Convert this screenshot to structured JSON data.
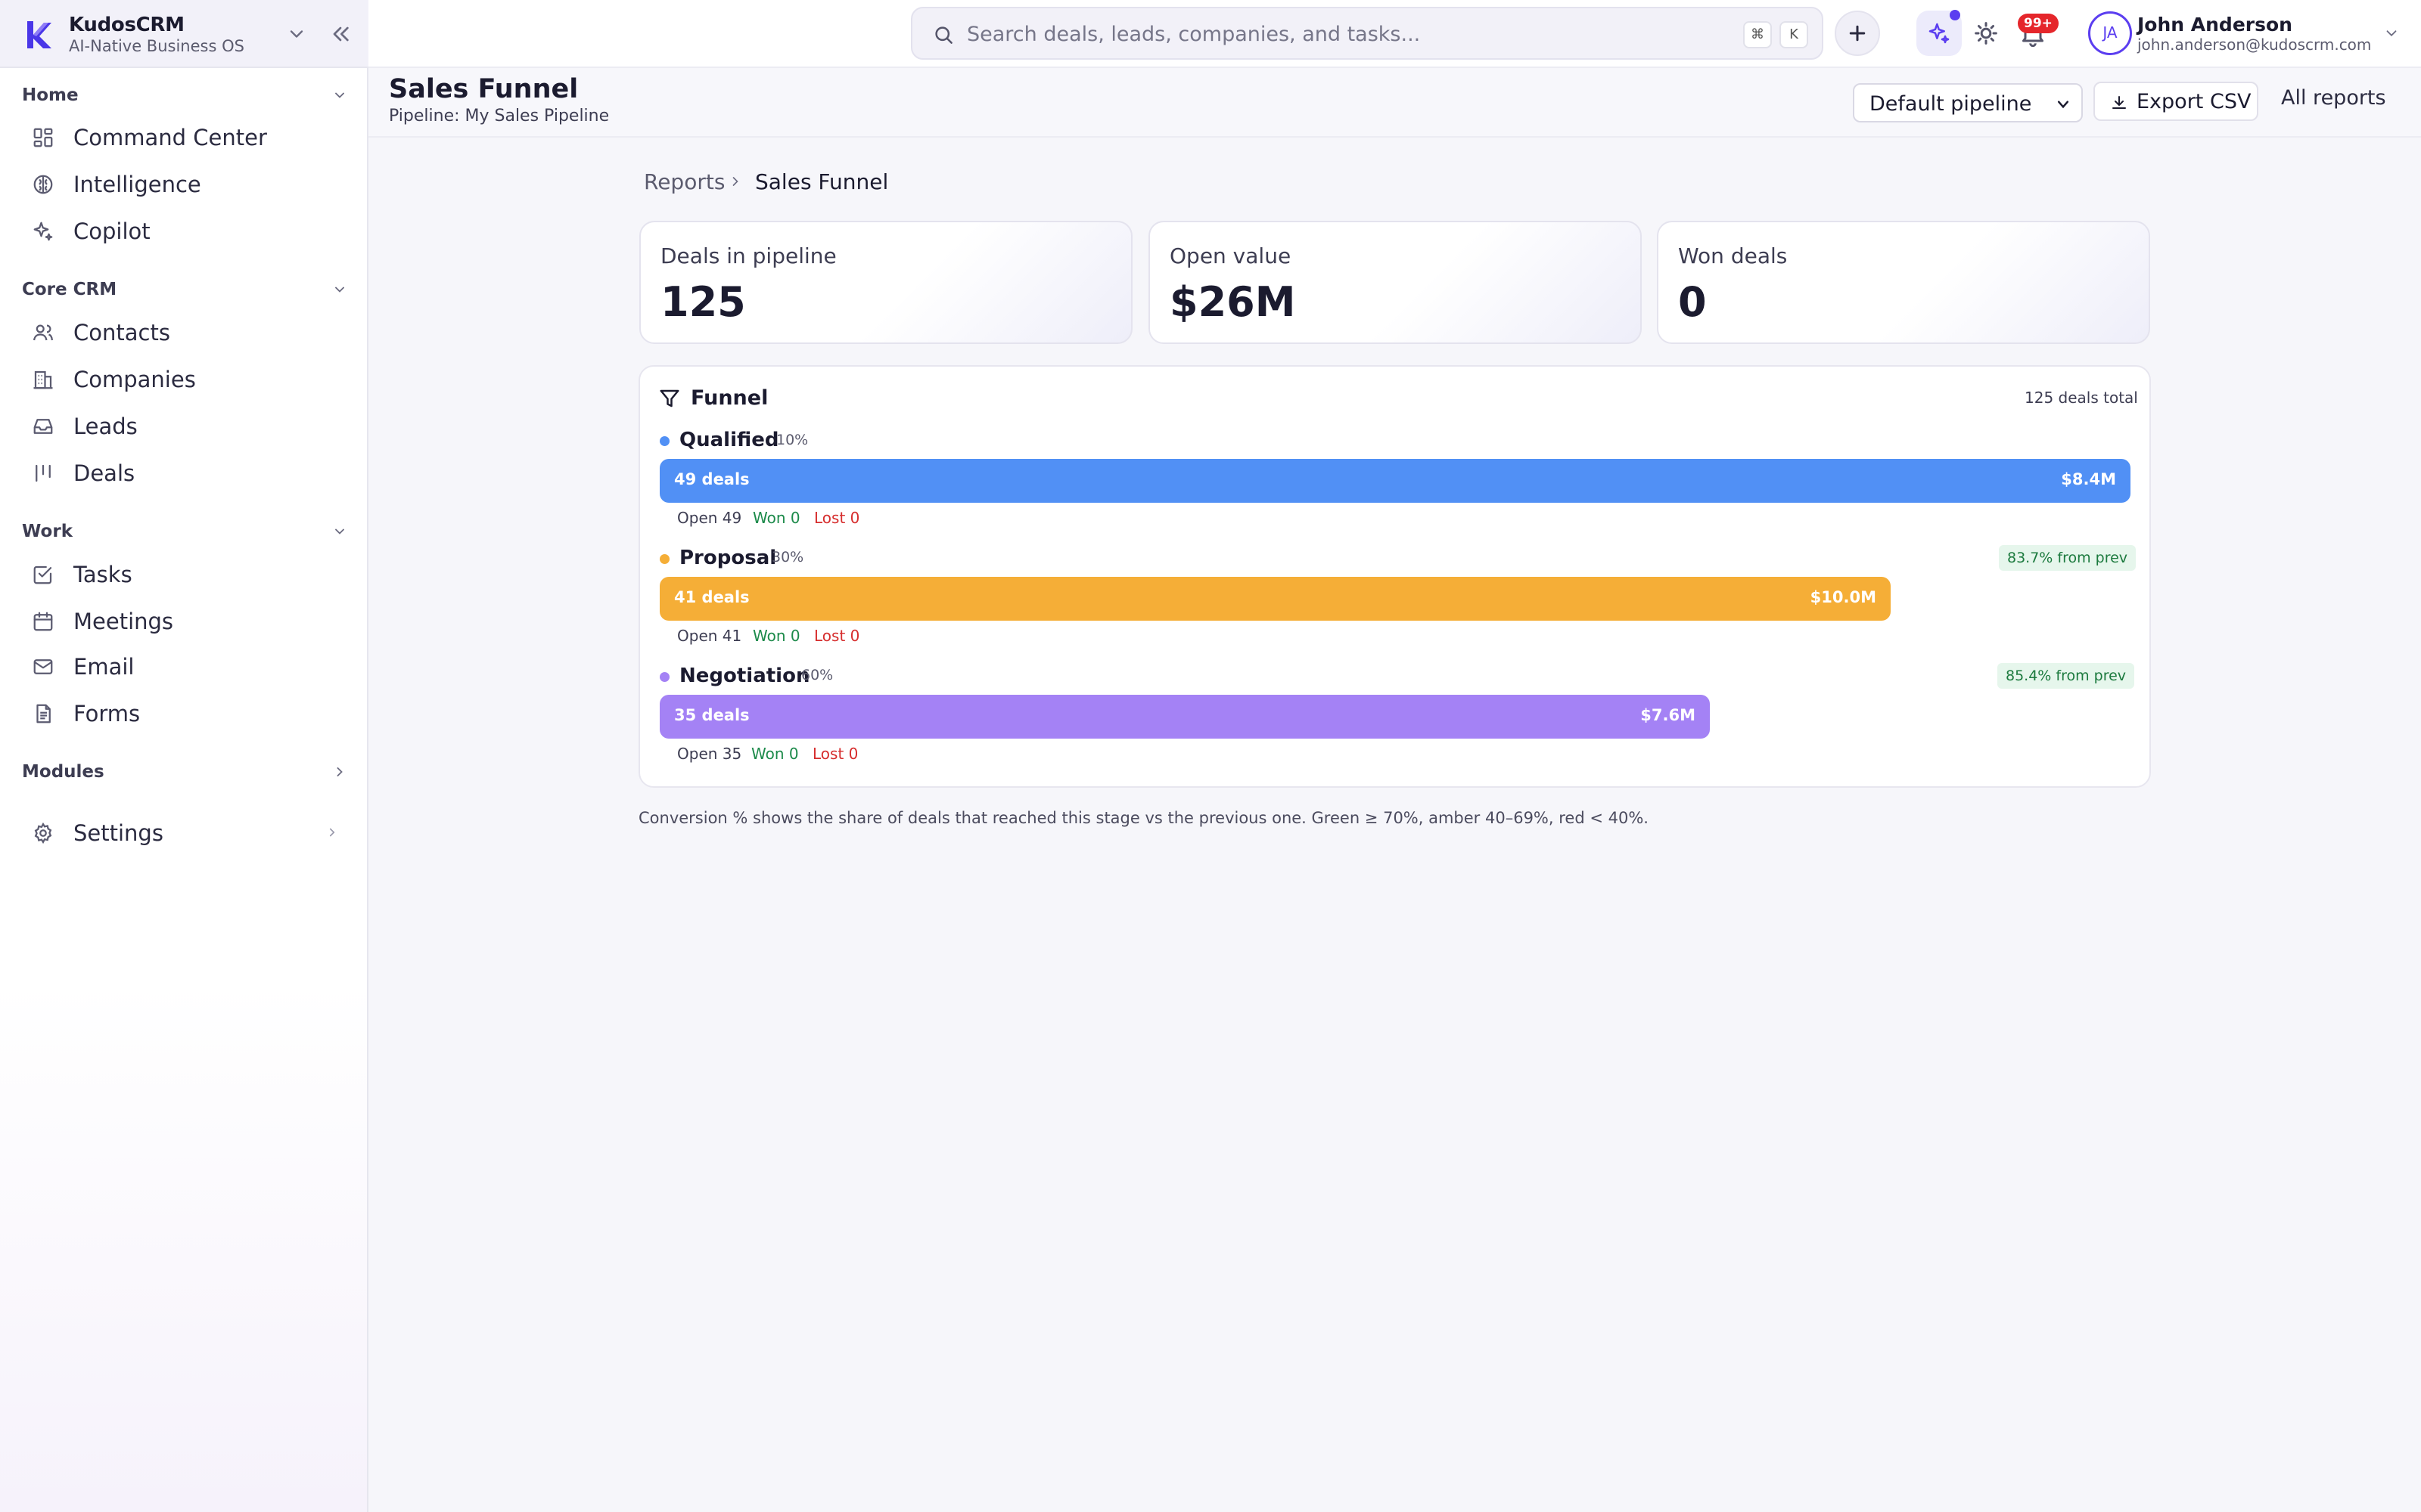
{
  "brand": {
    "name": "KudosCRM",
    "tagline": "AI-Native Business OS"
  },
  "sidebar": {
    "sections": {
      "home": "Home",
      "core": "Core CRM",
      "work": "Work",
      "modules": "Modules"
    },
    "items": {
      "command_center": "Command Center",
      "intelligence": "Intelligence",
      "copilot": "Copilot",
      "contacts": "Contacts",
      "companies": "Companies",
      "leads": "Leads",
      "deals": "Deals",
      "tasks": "Tasks",
      "meetings": "Meetings",
      "email": "Email",
      "forms": "Forms",
      "settings": "Settings"
    }
  },
  "topbar": {
    "search_placeholder": "Search deals, leads, companies, and tasks...",
    "shortcut_keys": [
      "⌘",
      "K"
    ],
    "notification_badge": "99+",
    "user": {
      "initials": "JA",
      "name": "John Anderson",
      "email": "john.anderson@kudoscrm.com"
    }
  },
  "page": {
    "title": "Sales Funnel",
    "subtitle": "Pipeline: My Sales Pipeline",
    "pipeline_select": "Default pipeline",
    "export_label": "Export CSV",
    "all_reports_label": "All reports"
  },
  "breadcrumb": {
    "root": "Reports",
    "current": "Sales Funnel"
  },
  "kpis": [
    {
      "label": "Deals in pipeline",
      "value": "125"
    },
    {
      "label": "Open value",
      "value": "$26M"
    },
    {
      "label": "Won deals",
      "value": "0"
    }
  ],
  "funnel": {
    "title": "Funnel",
    "total": "125 deals total",
    "stages": [
      {
        "name": "Qualified",
        "probability": "10%",
        "deals_label": "49 deals",
        "value_label": "$8.4M",
        "open": "Open 49",
        "won": "Won 0",
        "lost": "Lost 0",
        "conversion": "",
        "fill_fraction": 1.0,
        "color": "#5190f5"
      },
      {
        "name": "Proposal",
        "probability": "30%",
        "deals_label": "41 deals",
        "value_label": "$10.0M",
        "open": "Open 41",
        "won": "Won 0",
        "lost": "Lost 0",
        "conversion": "83.7% from prev",
        "fill_fraction": 0.837,
        "color": "#f5ae37"
      },
      {
        "name": "Negotiation",
        "probability": "60%",
        "deals_label": "35 deals",
        "value_label": "$7.6M",
        "open": "Open 35",
        "won": "Won 0",
        "lost": "Lost 0",
        "conversion": "85.4% from prev",
        "fill_fraction": 0.714,
        "color": "#a482f5"
      }
    ]
  },
  "footnote": "Conversion % shows the share of deals that reached this stage vs the previous one. Green ≥ 70%, amber 40–69%, red < 40%.",
  "colors": {
    "accent": "#5b3ef0",
    "won": "#1c8a4a",
    "lost": "#d62d2d"
  }
}
